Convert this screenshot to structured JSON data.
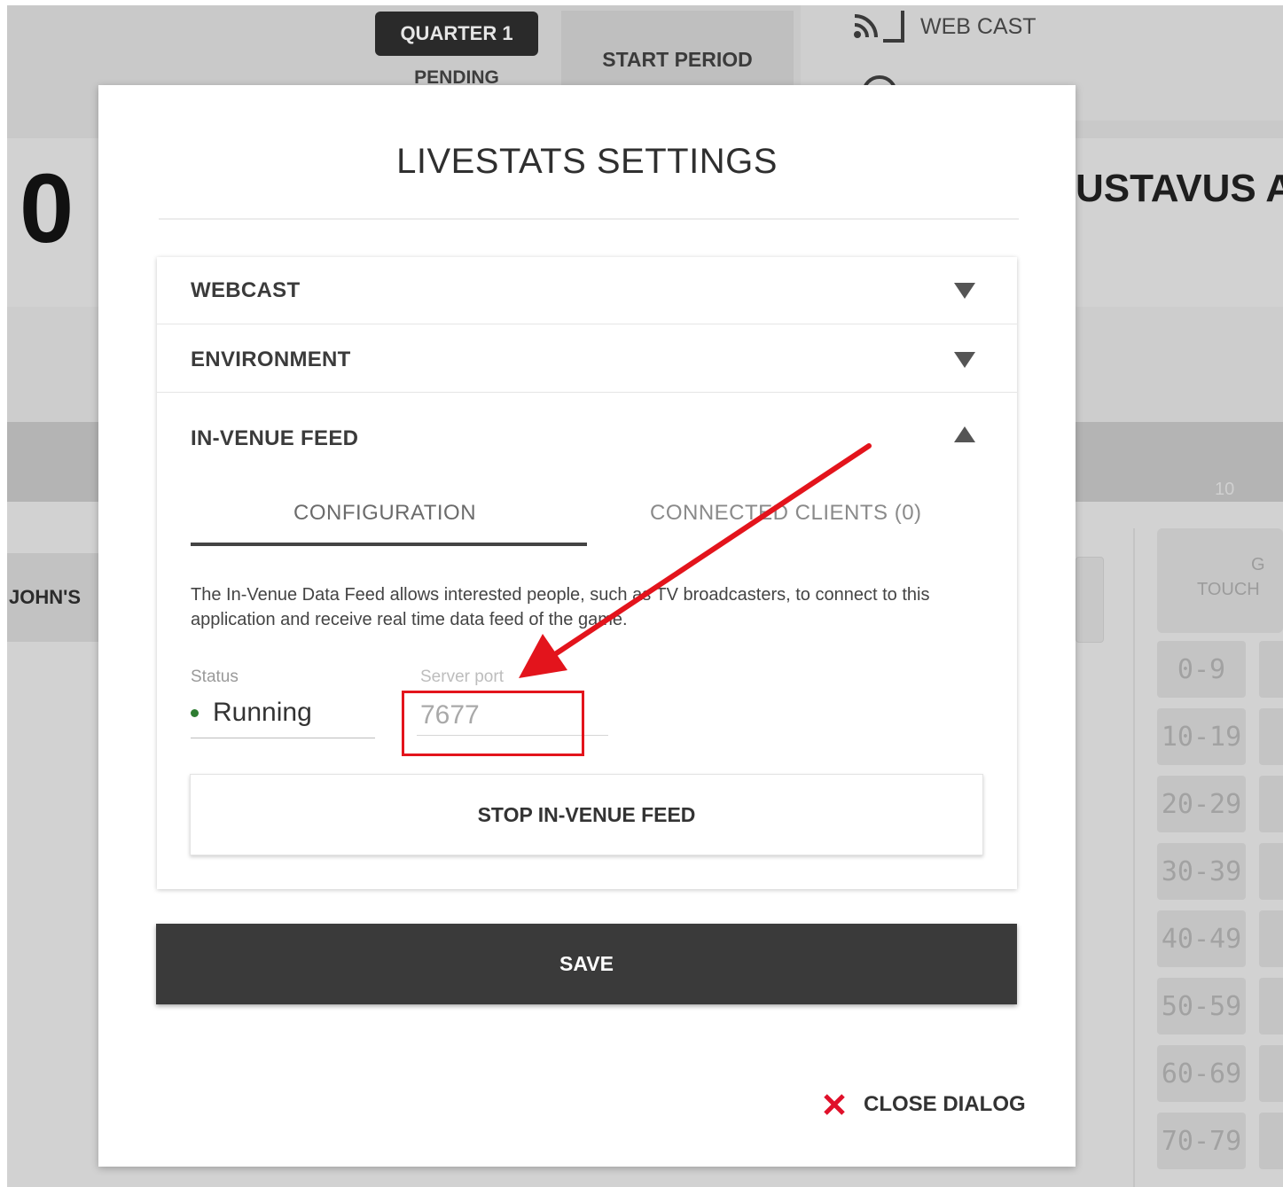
{
  "background": {
    "quarter_label": "QUARTER 1",
    "quarter_status": "PENDING",
    "start_period_label": "START PERIOD",
    "webcast_label": "WEB CAST",
    "home_score": "0",
    "away_team": "USTAVUS A",
    "home_team": "JOHN'S",
    "touch_top": "G",
    "touch_label": "TOUCH",
    "band_number": "10",
    "yard_ranges": [
      "0-9",
      "10-19",
      "20-29",
      "30-39",
      "40-49",
      "50-59",
      "60-69",
      "70-79"
    ]
  },
  "dialog": {
    "title": "LIVESTATS SETTINGS",
    "sections": [
      {
        "label": "WEBCAST",
        "expanded": false
      },
      {
        "label": "ENVIRONMENT",
        "expanded": false
      },
      {
        "label": "IN-VENUE FEED",
        "expanded": true
      }
    ],
    "tabs": [
      {
        "label": "CONFIGURATION",
        "active": true
      },
      {
        "label": "CONNECTED CLIENTS (0)",
        "active": false
      }
    ],
    "description": "The In-Venue Data Feed allows interested people, such as TV broadcasters, to connect to this application and receive real time data feed of the game.",
    "status_label": "Status",
    "status_value": "Running",
    "server_port_label": "Server port",
    "server_port_value": "7677",
    "stop_button": "STOP IN-VENUE FEED",
    "save_button": "SAVE",
    "close_label": "CLOSE DIALOG"
  },
  "colors": {
    "annotation_red": "#e3141c",
    "save_bg": "#3a3a3a",
    "status_green": "#2e7d32",
    "close_x": "#e0102a"
  },
  "icons": [
    "cast-icon",
    "smile-icon",
    "chevron-down-icon",
    "chevron-up-icon",
    "close-icon",
    "annotation-arrow-icon"
  ]
}
